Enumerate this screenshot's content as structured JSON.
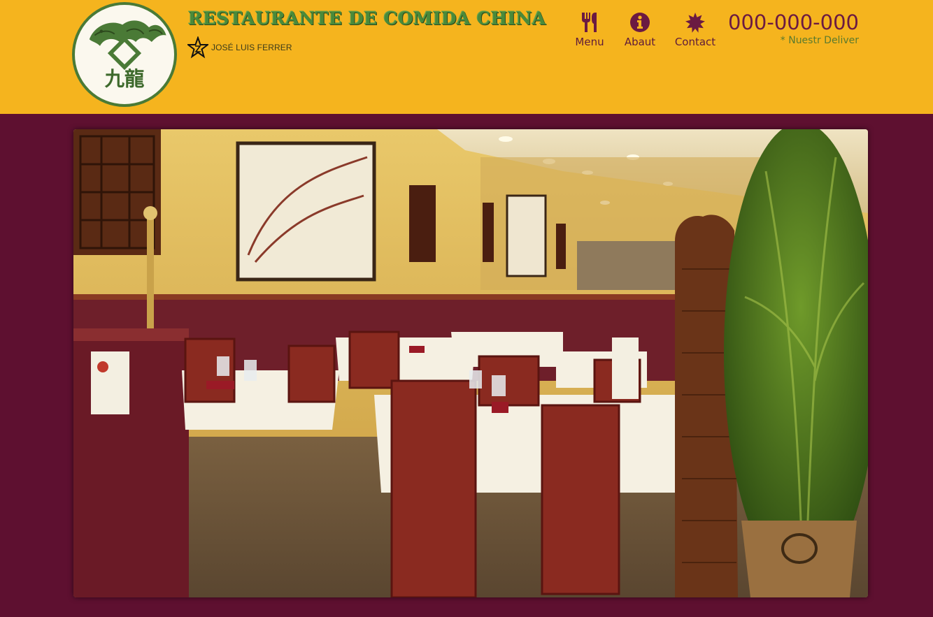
{
  "header": {
    "title": "RESTAURANTE DE COMIDA CHINA",
    "owner": "JOSÉ LUIS FERRER",
    "logo_chars": "九龍"
  },
  "nav": [
    {
      "label": "Menu",
      "icon": "fork-knife-icon"
    },
    {
      "label": "Abaut",
      "icon": "info-icon"
    },
    {
      "label": "Contact",
      "icon": "certificate-icon"
    }
  ],
  "phone": {
    "number": "000-000-000",
    "note": "* Nuestr Deliver"
  },
  "colors": {
    "header_bg": "#f5b41e",
    "page_bg": "#5e1030",
    "accent_green": "#4a8a3a",
    "accent_burgundy": "#6b1a42"
  },
  "hero": {
    "description_icon": "restaurant-interior-photo"
  }
}
